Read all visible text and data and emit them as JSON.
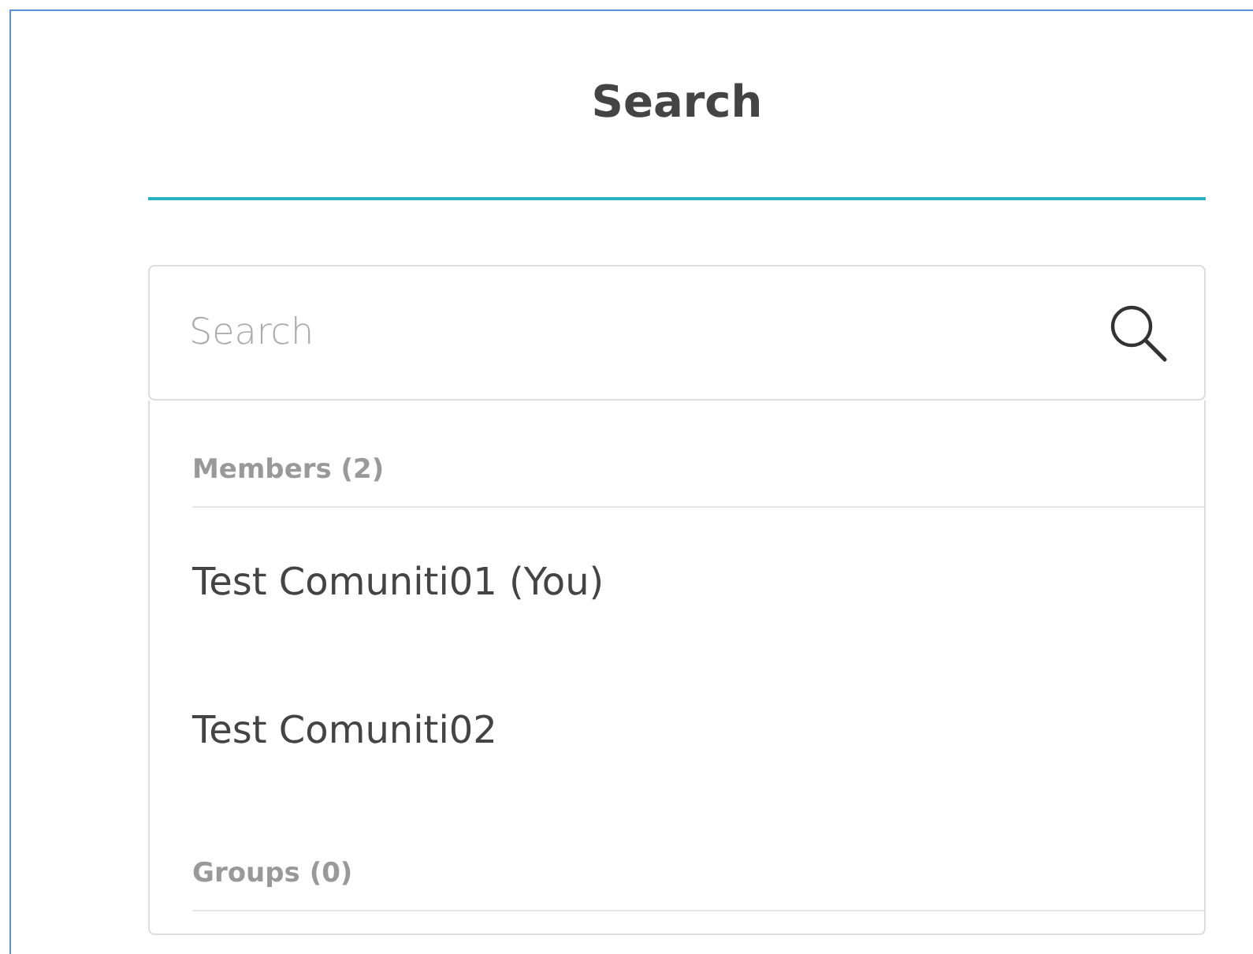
{
  "title": "Search",
  "search": {
    "placeholder": "Search"
  },
  "sections": [
    {
      "heading": "Members (2)",
      "items": [
        "Test Comuniti01 (You)",
        "Test Comuniti02"
      ]
    },
    {
      "heading": "Groups (0)"
    }
  ]
}
